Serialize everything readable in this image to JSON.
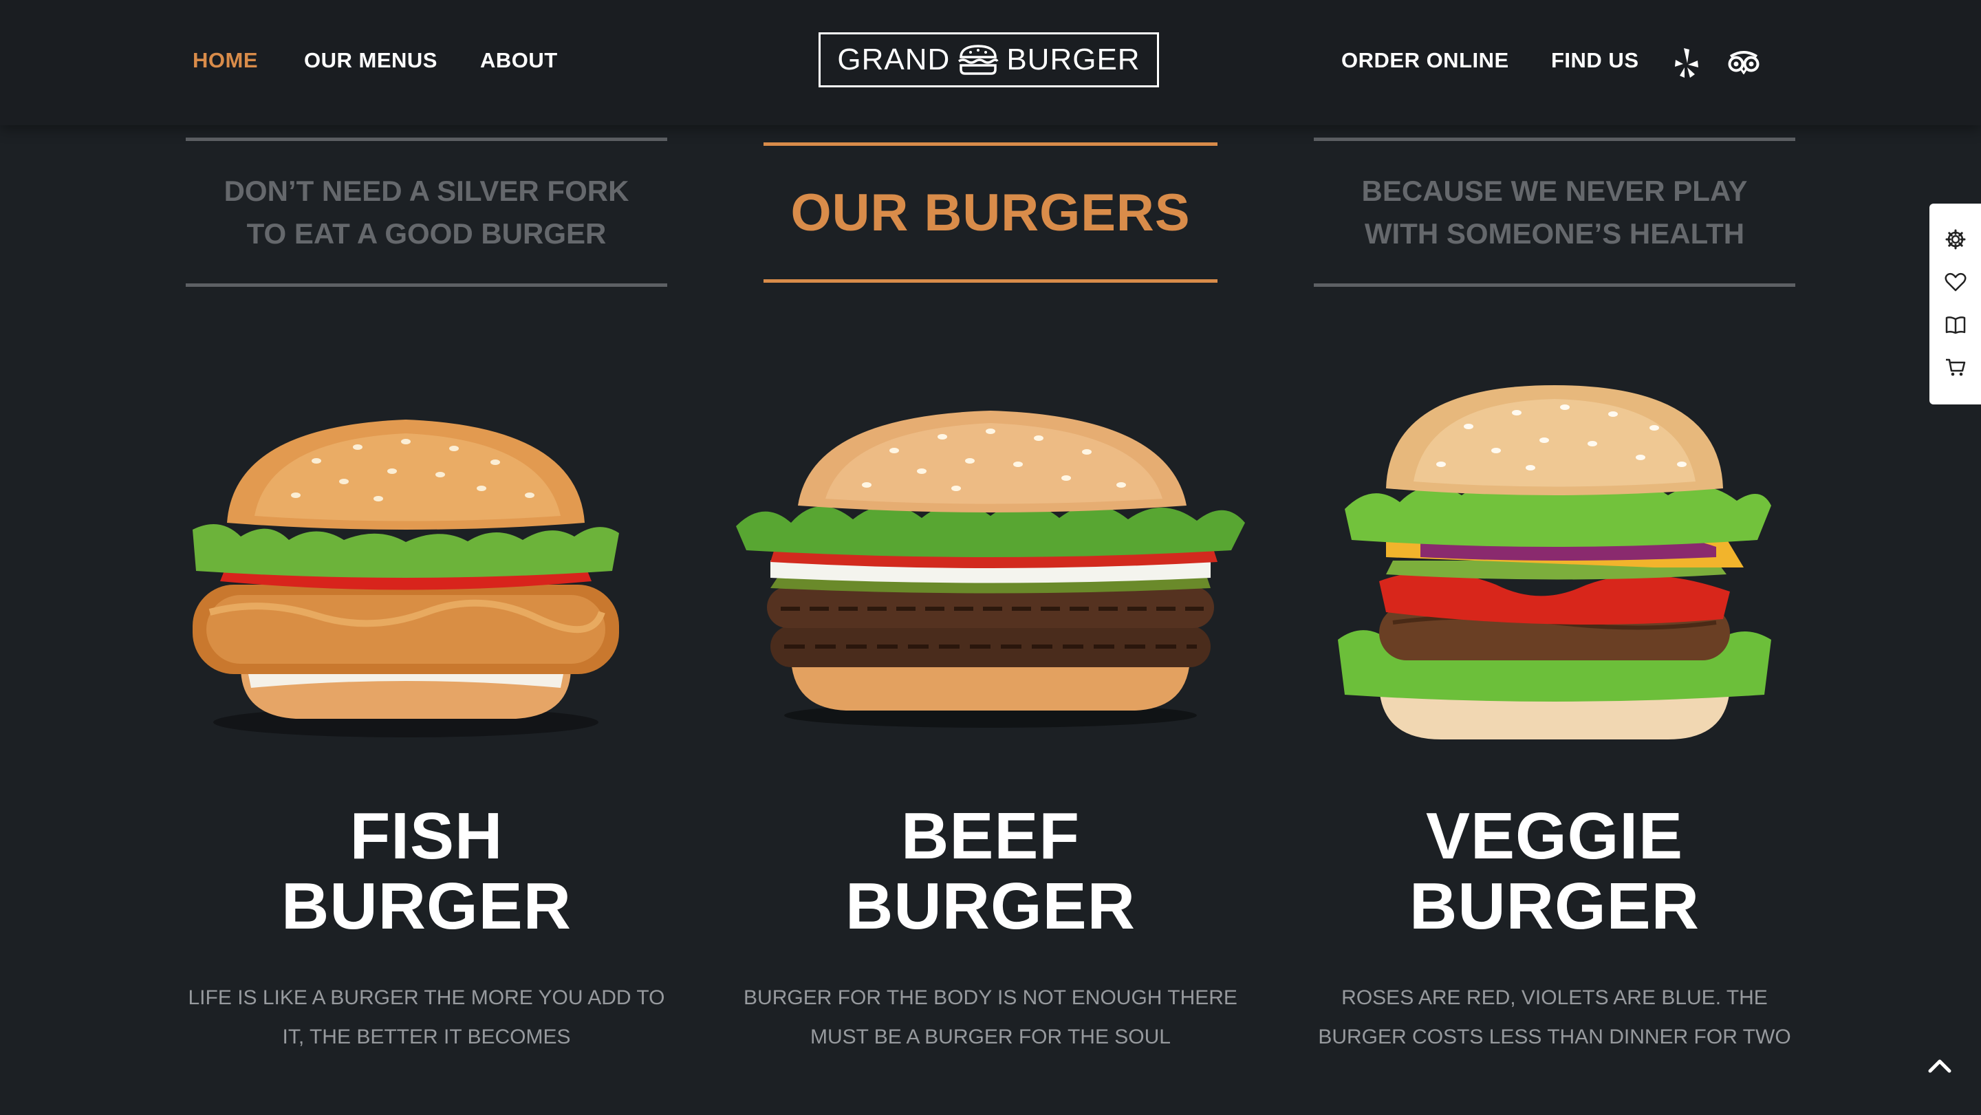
{
  "nav": {
    "left": [
      "HOME",
      "OUR MENUS",
      "ABOUT"
    ],
    "right": [
      "ORDER ONLINE",
      "FIND US"
    ],
    "active": "HOME",
    "social_icons": [
      "yelp-icon",
      "tripadvisor-icon"
    ]
  },
  "logo": {
    "left": "GRAND",
    "right": "BURGER",
    "icon": "burger-icon"
  },
  "headings": {
    "left": [
      "DON’T NEED A SILVER FORK",
      "TO EAT A GOOD BURGER"
    ],
    "center": "OUR BURGERS",
    "right": [
      "BECAUSE WE NEVER PLAY",
      "WITH SOMEONE’S HEALTH"
    ]
  },
  "burgers": [
    {
      "name": [
        "FISH",
        "BURGER"
      ],
      "desc": [
        "LIFE IS LIKE A BURGER THE MORE YOU ADD TO",
        "IT, THE BETTER IT BECOMES"
      ]
    },
    {
      "name": [
        "BEEF",
        "BURGER"
      ],
      "desc": [
        "BURGER FOR THE BODY IS NOT ENOUGH THERE",
        "MUST BE A BURGER FOR THE SOUL"
      ]
    },
    {
      "name": [
        "VEGGIE",
        "BURGER"
      ],
      "desc": [
        "ROSES ARE RED, VIOLETS ARE BLUE. THE",
        "BURGER COSTS LESS THAN DINNER FOR TWO"
      ]
    }
  ],
  "side_panel_icons": [
    "gear-icon",
    "heart-icon",
    "book-icon",
    "cart-icon"
  ],
  "colors": {
    "accent": "#d98c4a",
    "background": "#1c2024",
    "header": "#1a1d21",
    "muted": "#65686c"
  }
}
